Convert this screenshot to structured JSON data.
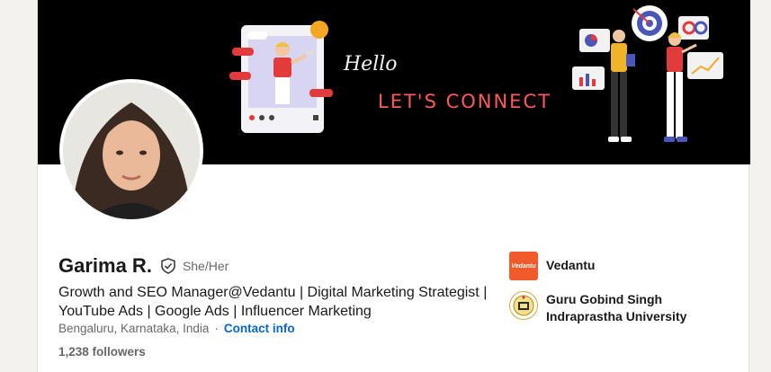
{
  "banner": {
    "script_text": "Hello",
    "tagline": "LET'S CONNECT",
    "colors": {
      "background": "#000000",
      "neon": "#ff4d4d"
    }
  },
  "profile": {
    "name": "Garima R.",
    "verified_icon": "shield-check-icon",
    "pronouns": "She/Her",
    "headline": "Growth and SEO Manager@Vedantu | Digital Marketing Strategist | YouTube Ads | Google Ads | Influencer Marketing",
    "location": "Bengaluru, Karnataka, India",
    "separator": "·",
    "contact_label": "Contact info",
    "followers": "1,238 followers"
  },
  "organizations": [
    {
      "name": "Vedantu",
      "logo_text": "Vedantu",
      "logo_color": "#f15a29"
    },
    {
      "name": "Guru Gobind Singh Indraprastha University"
    }
  ],
  "colors": {
    "link": "#0a66c2"
  }
}
